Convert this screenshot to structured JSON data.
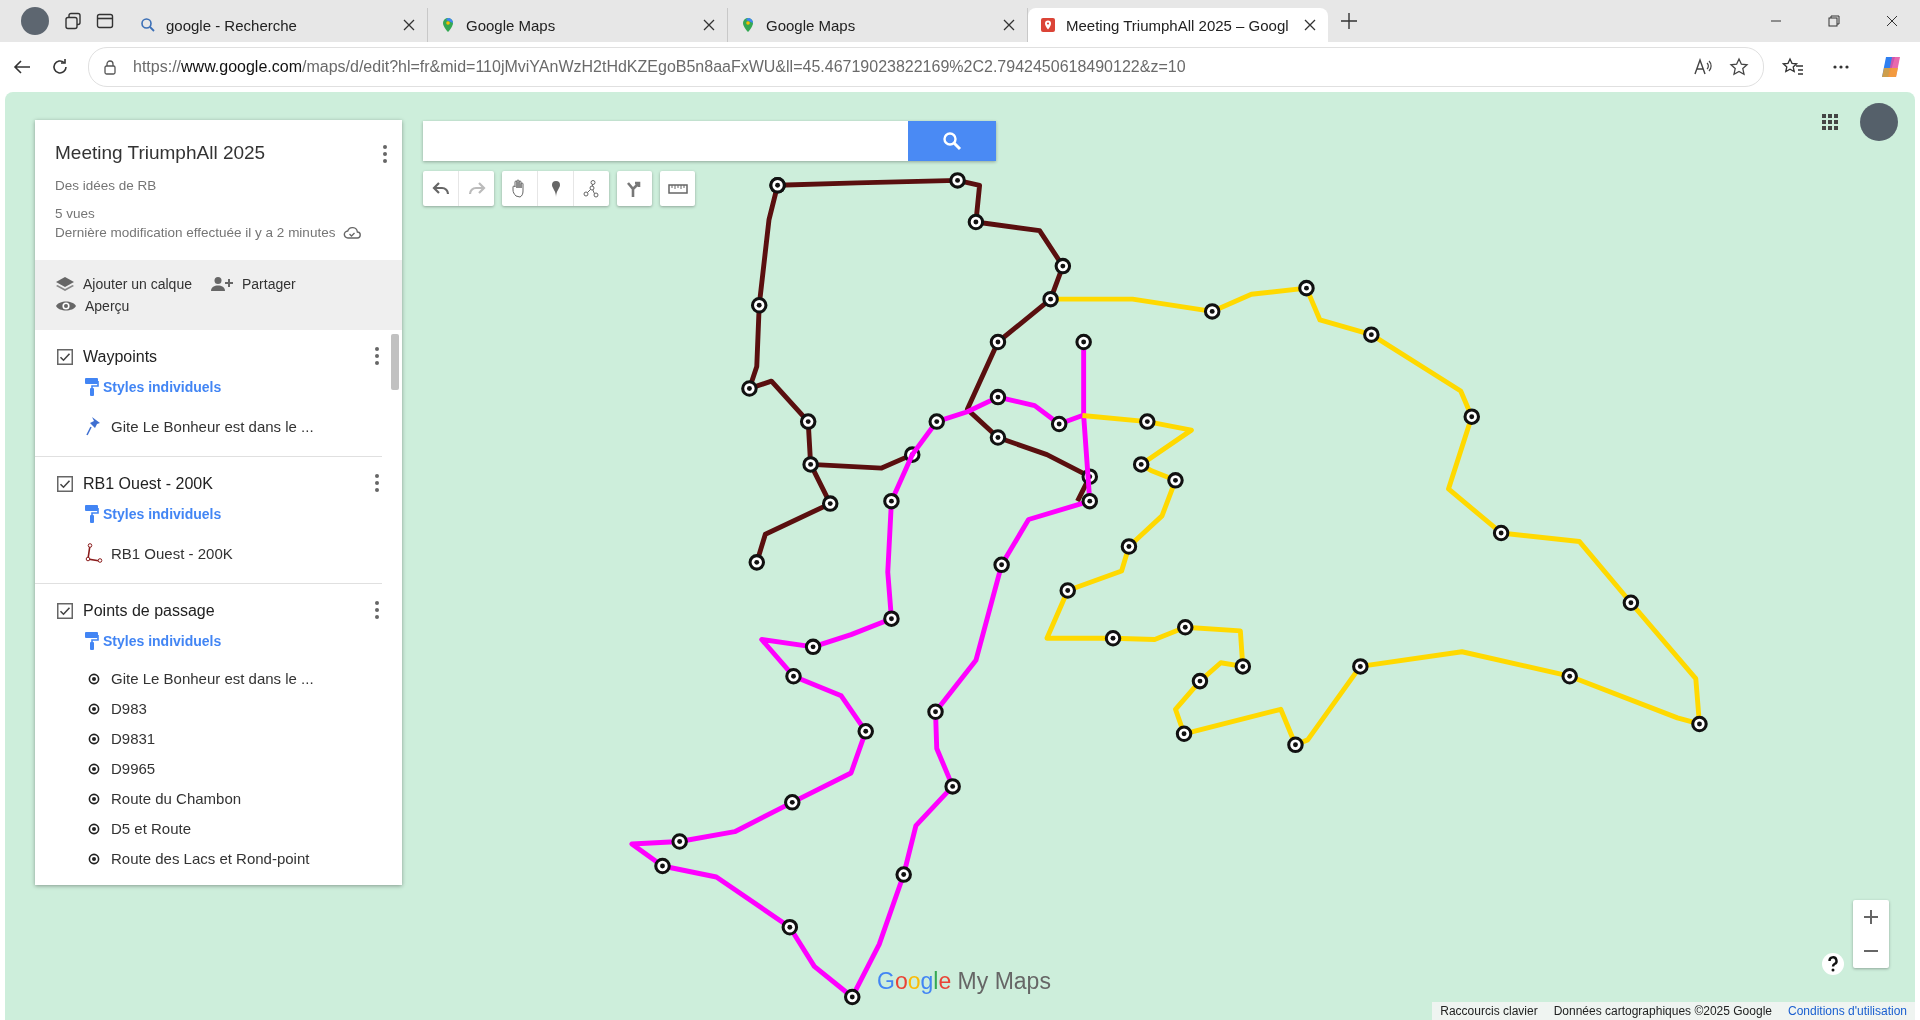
{
  "browser": {
    "tabs": [
      {
        "title": "google - Recherche",
        "kind": "search",
        "selected": false
      },
      {
        "title": "Google Maps",
        "kind": "maps",
        "selected": false
      },
      {
        "title": "Google Maps",
        "kind": "maps",
        "selected": false
      },
      {
        "title": "Meeting TriumphAll 2025 – Googl",
        "kind": "mymaps",
        "selected": true
      }
    ],
    "address": {
      "scheme": "https://",
      "host": "www.google.com",
      "path": "/maps/d/edit?hl=fr&mid=110jMviYAnWzH2tHdKZEgoB5n8aaFxWU&ll=45.46719023822169%2C2.7942450618490122&z=10"
    }
  },
  "panel": {
    "title": "Meeting TriumphAll 2025",
    "description": "Des idées de RB",
    "views": "5 vues",
    "last_modified": "Dernière modification effectuée il y a 2 minutes",
    "actions": [
      {
        "label": "Ajouter un calque",
        "kind": "layer"
      },
      {
        "label": "Partager",
        "kind": "share"
      },
      {
        "label": "Aperçu",
        "kind": "preview"
      }
    ],
    "layers": [
      {
        "name": "Waypoints",
        "checked": true,
        "style_link": "Styles individuels",
        "items": [
          {
            "label": "Gite Le Bonheur est dans le ...",
            "kind": "pin"
          }
        ]
      },
      {
        "name": "RB1 Ouest - 200K",
        "checked": true,
        "style_link": "Styles individuels",
        "items": [
          {
            "label": "RB1 Ouest - 200K",
            "kind": "line"
          }
        ]
      },
      {
        "name": "Points de passage",
        "checked": true,
        "style_link": "Styles individuels",
        "items": [
          {
            "label": "Gite Le Bonheur est dans le ...",
            "kind": "point"
          },
          {
            "label": "D983",
            "kind": "point"
          },
          {
            "label": "D9831",
            "kind": "point"
          },
          {
            "label": "D9965",
            "kind": "point"
          },
          {
            "label": "Route du Chambon",
            "kind": "point"
          },
          {
            "label": "D5 et Route",
            "kind": "point"
          },
          {
            "label": "Route des Lacs et Rond-point",
            "kind": "point"
          }
        ]
      }
    ]
  },
  "map": {
    "logo": {
      "brand": "Google",
      "product": "My Maps"
    },
    "footer": [
      {
        "text": "Raccourcis clavier",
        "kind": "plain"
      },
      {
        "text": "Données cartographiques ©2025 Google",
        "kind": "plain"
      },
      {
        "text": "Conditions d'utilisation",
        "kind": "link"
      }
    ]
  }
}
